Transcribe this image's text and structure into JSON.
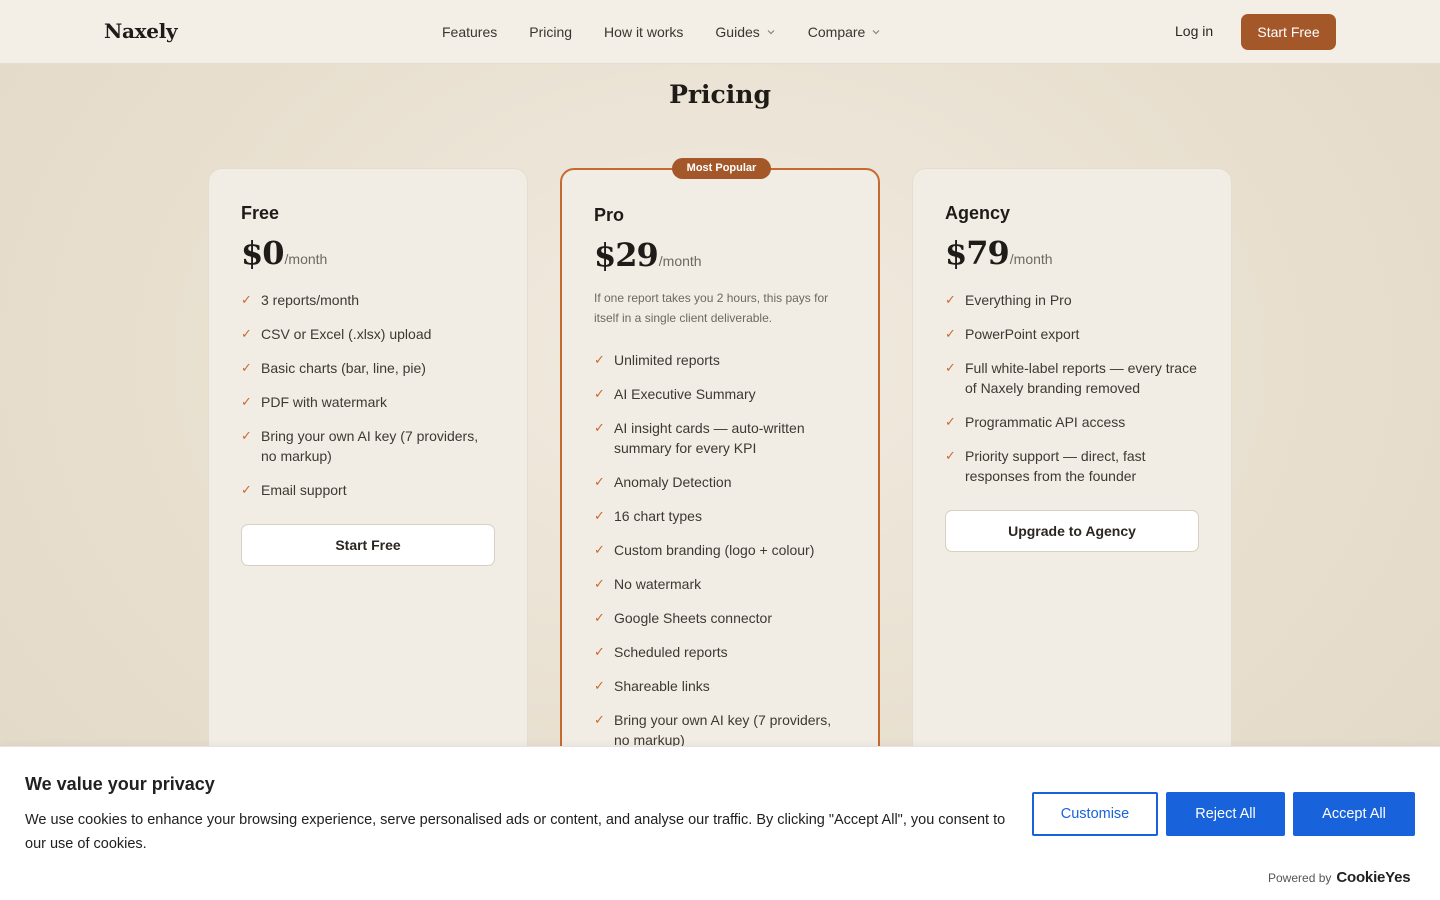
{
  "nav": {
    "logo": "Naxely",
    "links": [
      "Features",
      "Pricing",
      "How it works",
      "Guides",
      "Compare"
    ],
    "login": "Log in",
    "start": "Start Free"
  },
  "page": {
    "title": "Pricing"
  },
  "plans": [
    {
      "name": "Free",
      "price": "$0",
      "period": "/month",
      "features": [
        "3 reports/month",
        "CSV or Excel (.xlsx) upload",
        "Basic charts (bar, line, pie)",
        "PDF with watermark",
        "Bring your own AI key (7 providers, no markup)",
        "Email support"
      ],
      "cta": "Start Free"
    },
    {
      "name": "Pro",
      "badge": "Most Popular",
      "price": "$29",
      "period": "/month",
      "pitch": "If one report takes you 2 hours, this pays for itself in a single client deliverable.",
      "features": [
        "Unlimited reports",
        "AI Executive Summary",
        "AI insight cards — auto-written summary for every KPI",
        "Anomaly Detection",
        "16 chart types",
        "Custom branding (logo + colour)",
        "No watermark",
        "Google Sheets connector",
        "Scheduled reports",
        "Shareable links",
        "Bring your own AI key (7 providers, no markup)"
      ]
    },
    {
      "name": "Agency",
      "price": "$79",
      "period": "/month",
      "features": [
        "Everything in Pro",
        "PowerPoint export",
        "Full white-label reports — every trace of Naxely branding removed",
        "Programmatic API access",
        "Priority support — direct, fast responses from the founder"
      ],
      "cta": "Upgrade to Agency"
    }
  ],
  "cookie": {
    "title": "We value your privacy",
    "text": "We use cookies to enhance your browsing experience, serve personalised ads or content, and analyse our traffic. By clicking \"Accept All\", you consent to our use of cookies.",
    "customise": "Customise",
    "reject": "Reject All",
    "accept": "Accept All",
    "powered_by": "Powered by",
    "brand": "CookieYes"
  },
  "colors": {
    "accent": "#a4582a",
    "pro_border": "#c86a30",
    "cookie_blue": "#1863dc"
  }
}
